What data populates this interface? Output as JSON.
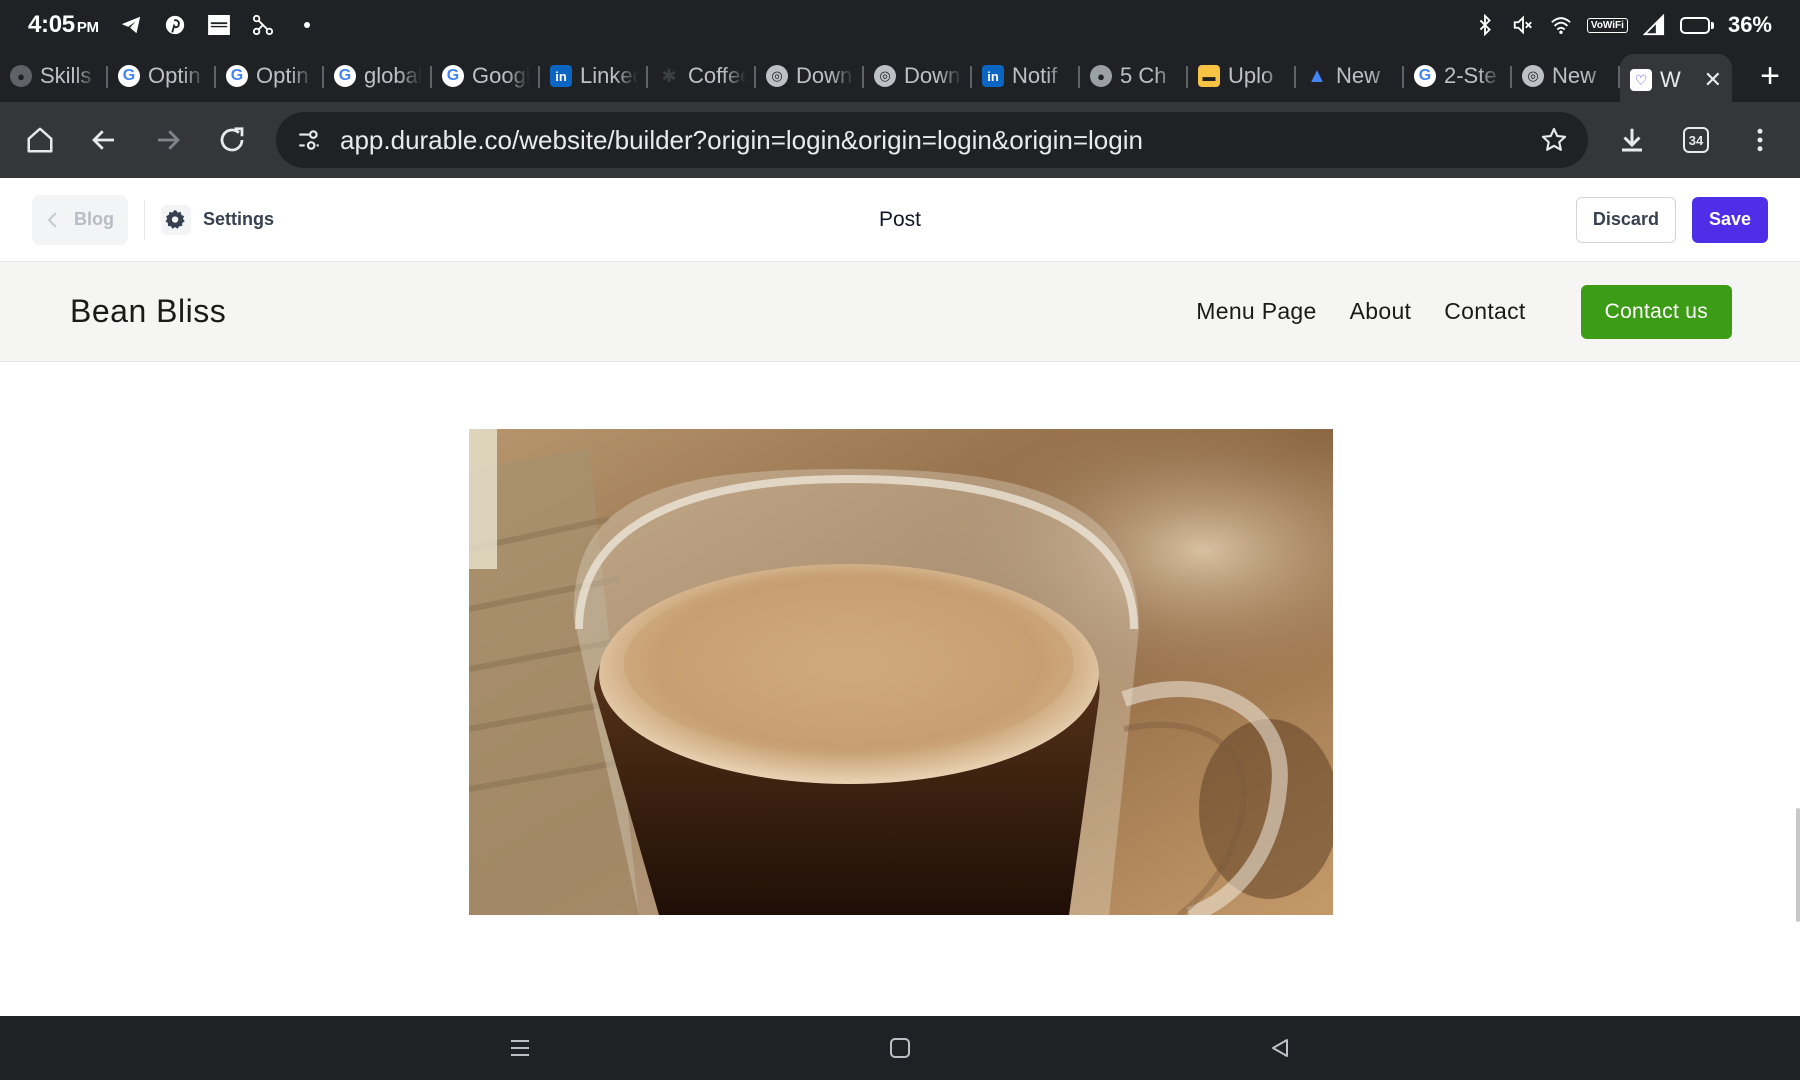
{
  "status_bar": {
    "time": "4:05",
    "ampm": "PM",
    "battery": "36%",
    "battery_level": 0.36,
    "wifi_label": "VoWiFi",
    "icons": [
      "telegram-icon",
      "pinterest-icon",
      "news-icon",
      "network-icon",
      "dot-icon",
      "bluetooth-icon",
      "mute-icon",
      "wifi-icon",
      "signal-icon",
      "battery-icon"
    ]
  },
  "tabs": [
    {
      "title": "Skills",
      "favicon": "dark",
      "icon": "generic-favicon-icon"
    },
    {
      "title": "Optin",
      "favicon": "google",
      "icon": "google-icon"
    },
    {
      "title": "Optin",
      "favicon": "google",
      "icon": "google-icon"
    },
    {
      "title": "global",
      "favicon": "google",
      "icon": "google-icon"
    },
    {
      "title": "Google",
      "favicon": "google",
      "icon": "google-icon"
    },
    {
      "title": "LinkedIn",
      "favicon": "linkedin",
      "icon": "linkedin-icon"
    },
    {
      "title": "Coffee",
      "favicon": "coffee",
      "icon": "coffee-icon"
    },
    {
      "title": "Down",
      "favicon": "chrome",
      "icon": "chrome-icon"
    },
    {
      "title": "Down",
      "favicon": "chrome",
      "icon": "chrome-icon"
    },
    {
      "title": "Notif",
      "favicon": "linkedin",
      "icon": "linkedin-icon"
    },
    {
      "title": "5 Ch",
      "favicon": "globe",
      "icon": "globe-icon"
    },
    {
      "title": "Uplo",
      "favicon": "upload",
      "icon": "upload-icon"
    },
    {
      "title": "New",
      "favicon": "ads",
      "icon": "google-ads-icon"
    },
    {
      "title": "2-Ste",
      "favicon": "google",
      "icon": "google-icon"
    },
    {
      "title": "New",
      "favicon": "chrome",
      "icon": "chrome-icon"
    },
    {
      "title": "W",
      "favicon": "durable",
      "icon": "durable-icon",
      "active": true
    }
  ],
  "toolbar": {
    "url": "app.durable.co/website/builder?origin=login&origin=login&origin=login",
    "tab_count": "34"
  },
  "builder": {
    "back_label": "Blog",
    "settings_label": "Settings",
    "page_title": "Post",
    "discard_label": "Discard",
    "save_label": "Save"
  },
  "site": {
    "brand": "Bean Bliss",
    "nav": [
      "Menu Page",
      "About",
      "Contact"
    ],
    "cta": "Contact us",
    "cta_color": "#3d9c15"
  },
  "colors": {
    "save": "#4f2ee8",
    "chrome_dark": "#202124",
    "toolbar": "#35363a"
  }
}
